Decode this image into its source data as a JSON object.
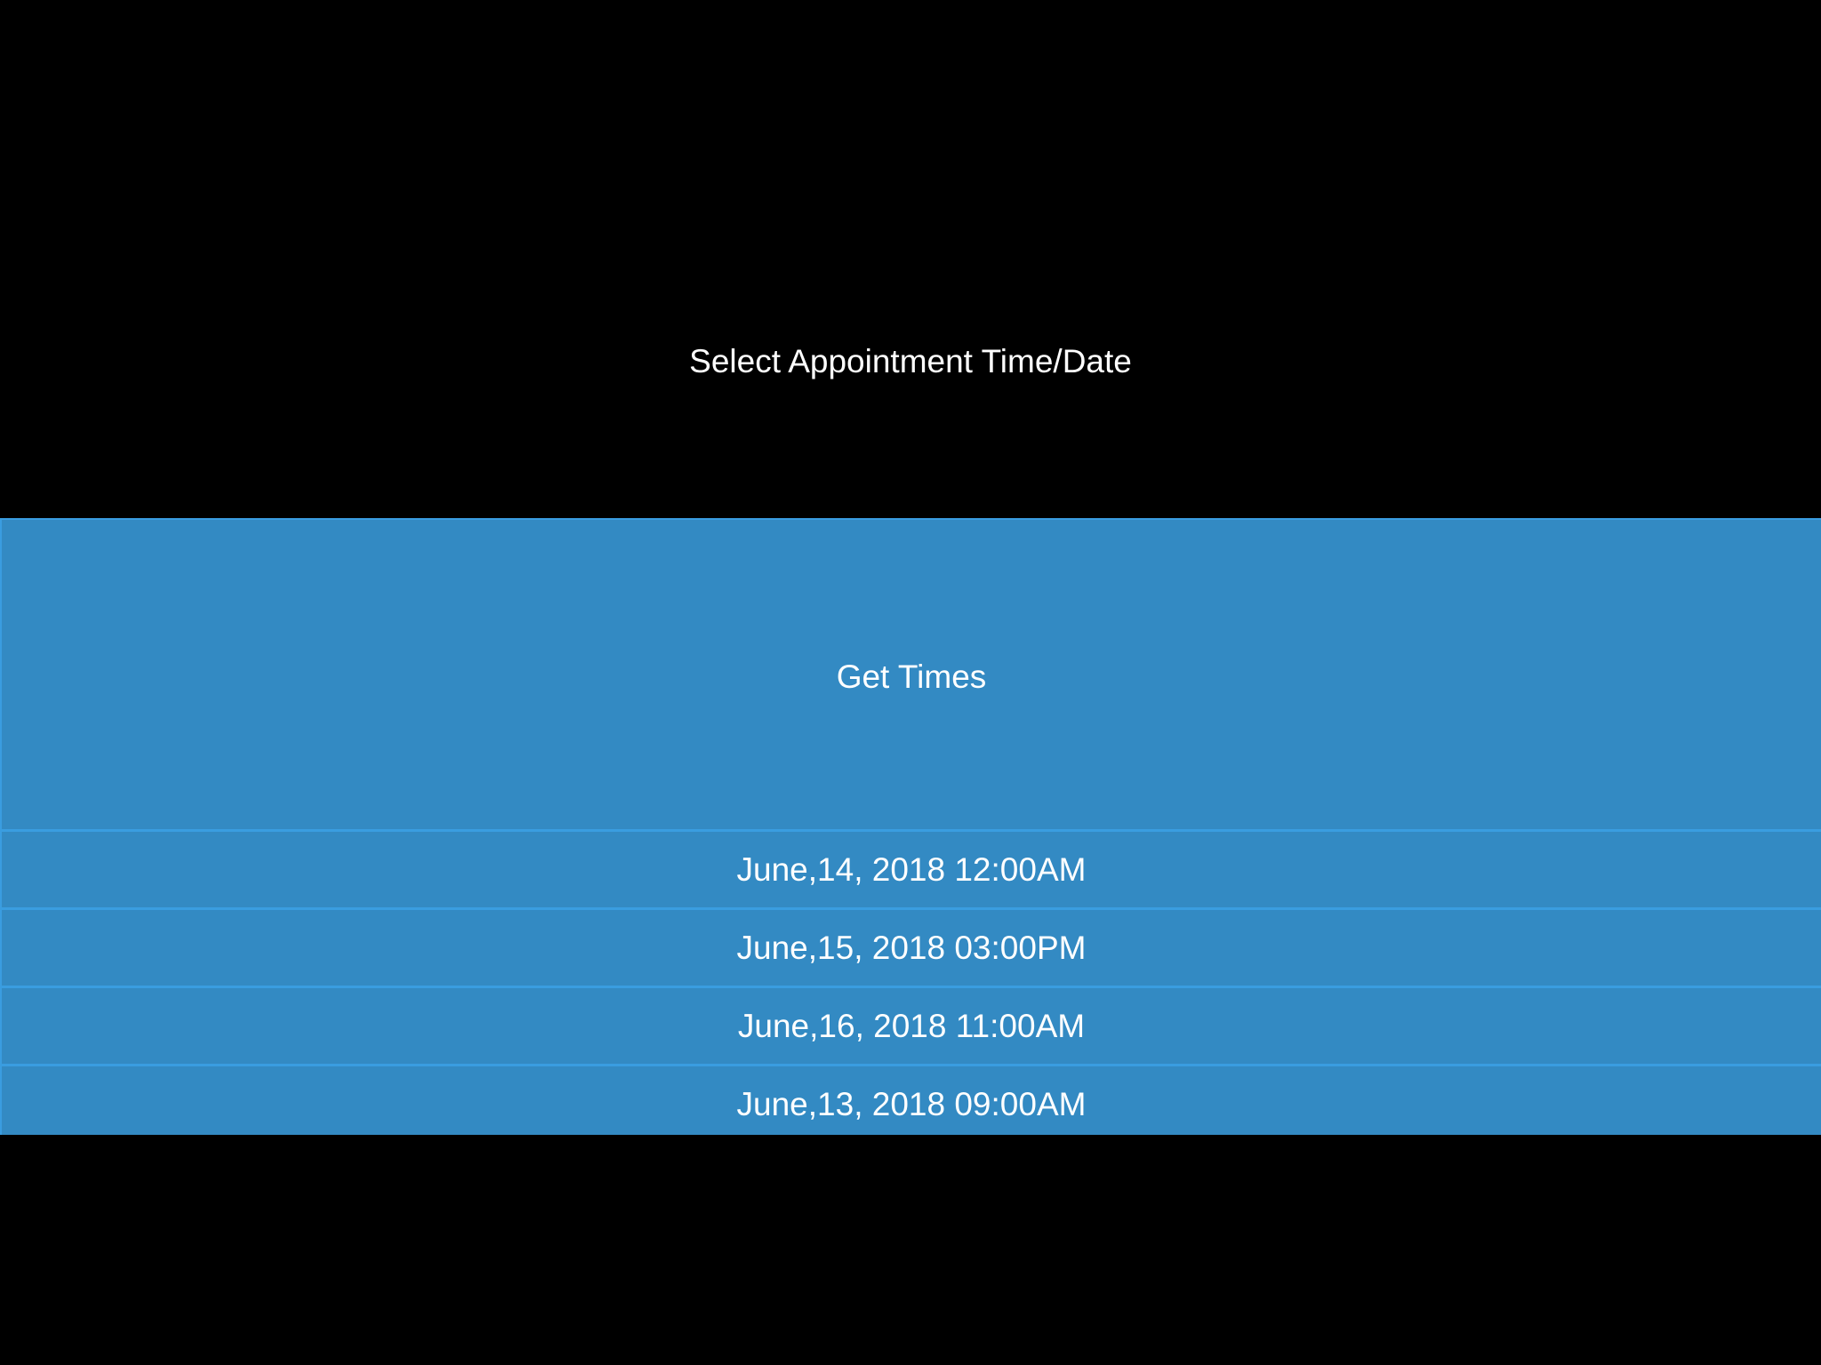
{
  "page": {
    "title": "Select Appointment Time/Date"
  },
  "actions": {
    "get_times_label": "Get Times"
  },
  "slots": [
    {
      "label": "June,14, 2018 12:00AM"
    },
    {
      "label": "June,15, 2018 03:00PM"
    },
    {
      "label": "June,16, 2018 11:00AM"
    },
    {
      "label": "June,13, 2018 09:00AM"
    }
  ],
  "colors": {
    "background": "#000000",
    "panel": "#338ac3",
    "divider": "#3a9de0",
    "text": "#ffffff"
  }
}
